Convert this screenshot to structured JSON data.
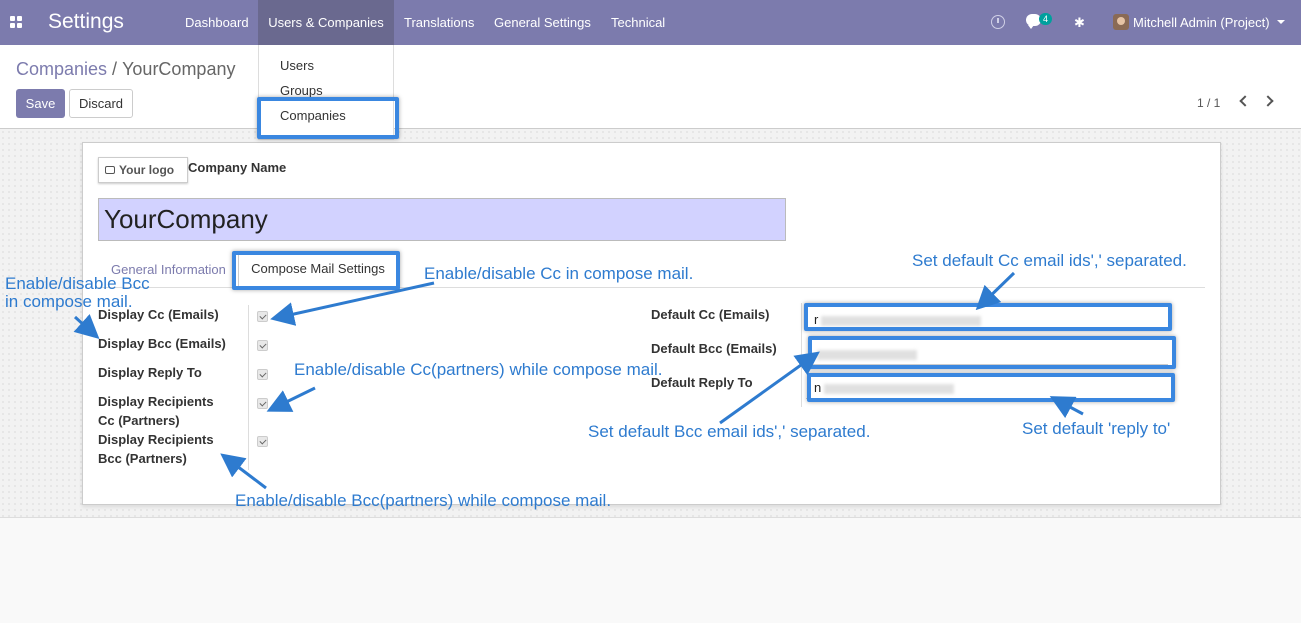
{
  "navbar": {
    "app_title": "Settings",
    "menus": [
      "Dashboard",
      "Users & Companies",
      "Translations",
      "General Settings",
      "Technical"
    ],
    "chat_badge": "4",
    "user": "Mitchell Admin (Project)"
  },
  "dropdown": {
    "items": [
      "Users",
      "Groups",
      "Companies"
    ]
  },
  "breadcrumb": {
    "parent": "Companies",
    "separator": "/",
    "current": "YourCompany"
  },
  "buttons": {
    "save": "Save",
    "discard": "Discard"
  },
  "pager": "1 / 1",
  "form": {
    "logo_button": "Your logo",
    "company_name_label": "Company Name",
    "company_name_value": "YourCompany",
    "tabs": [
      "General Information",
      "Compose Mail Settings"
    ],
    "left_fields": [
      {
        "label": "Display Cc (Emails)",
        "checked": true
      },
      {
        "label": "Display Bcc (Emails)",
        "checked": true
      },
      {
        "label": "Display Reply To",
        "checked": true
      },
      {
        "label_line1": "Display Recipients",
        "label_line2": "Cc (Partners)",
        "checked": true
      },
      {
        "label_line1": "Display Recipients",
        "label_line2": "Bcc (Partners)",
        "checked": true
      }
    ],
    "right_fields": [
      {
        "label": "Default Cc (Emails)",
        "value_prefix": "r"
      },
      {
        "label": "Default Bcc (Emails)",
        "value_prefix": ""
      },
      {
        "label": "Default Reply To",
        "value_prefix": "n"
      }
    ]
  },
  "annotations": {
    "bcc_line1": "Enable/disable Bcc",
    "bcc_line2": "in compose mail.",
    "cc": "Enable/disable Cc in compose mail.",
    "cc_partners": "Enable/disable Cc(partners) while compose mail.",
    "bcc_partners": "Enable/disable Bcc(partners) while compose mail.",
    "default_cc": "Set default Cc email ids',' separated.",
    "default_bcc": "Set default Bcc email ids',' separated.",
    "default_reply": "Set default 'reply to'"
  },
  "colors": {
    "navbar": "#7c7bad",
    "annotation": "#2e7bcf",
    "highlight": "#3a87e0",
    "company_input": "#d2d2ff"
  }
}
